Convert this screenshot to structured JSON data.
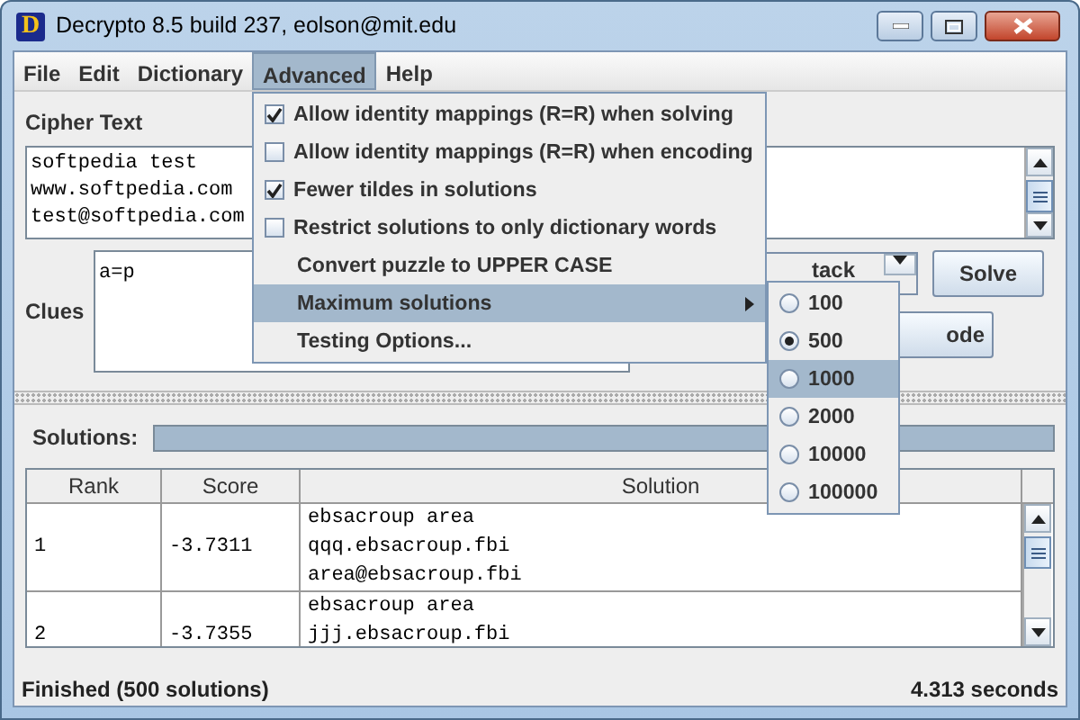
{
  "window": {
    "title": "Decrypto 8.5 build 237, eolson@mit.edu",
    "logo_letter": "D"
  },
  "menu_bar": [
    {
      "label": "File",
      "selected": false
    },
    {
      "label": "Edit",
      "selected": false
    },
    {
      "label": "Dictionary",
      "selected": false
    },
    {
      "label": "Advanced",
      "selected": true
    },
    {
      "label": "Help",
      "selected": false
    }
  ],
  "cipher_text": {
    "label": "Cipher Text",
    "lines": [
      "softpedia test",
      "www.softpedia.com",
      "test@softpedia.com"
    ]
  },
  "clues": {
    "label": "Clues",
    "value": "a=p"
  },
  "combo": {
    "value": "tack"
  },
  "solve_button": {
    "label": "Solve"
  },
  "encode_button": {
    "label": "ode"
  },
  "solutions": {
    "label": "Solutions:",
    "level": 1
  },
  "table": {
    "columns": [
      "Rank",
      "Score",
      "Solution"
    ],
    "rows": [
      {
        "rank": "1",
        "score": "-3.7311",
        "solution": [
          "ebsacroup area",
          "qqq.ebsacroup.fbi",
          "area@ebsacroup.fbi"
        ]
      },
      {
        "rank": "2",
        "score": "-3.7355",
        "solution": [
          "ebsacroup area",
          "jjj.ebsacroup.fbi"
        ]
      }
    ]
  },
  "status_bar": {
    "left": "Finished (500 solutions)",
    "right": "4.313 seconds"
  },
  "advanced_menu": [
    {
      "kind": "checkbox",
      "label": "Allow identity mappings (R=R) when solving",
      "checked": true,
      "selected": false
    },
    {
      "kind": "checkbox",
      "label": "Allow identity mappings (R=R) when encoding",
      "checked": false,
      "selected": false
    },
    {
      "kind": "checkbox",
      "label": "Fewer tildes in solutions",
      "checked": true,
      "selected": false
    },
    {
      "kind": "checkbox",
      "label": "Restrict solutions to only dictionary words",
      "checked": false,
      "selected": false
    },
    {
      "kind": "plain",
      "label": "Convert puzzle to UPPER CASE",
      "selected": false
    },
    {
      "kind": "submenu",
      "label": "Maximum solutions",
      "selected": true
    },
    {
      "kind": "plain",
      "label": "Testing Options...",
      "selected": false
    }
  ],
  "max_solutions_menu": [
    {
      "label": "100",
      "checked": false,
      "selected": false
    },
    {
      "label": "500",
      "checked": true,
      "selected": false
    },
    {
      "label": "1000",
      "checked": false,
      "selected": true
    },
    {
      "label": "2000",
      "checked": false,
      "selected": false
    },
    {
      "label": "10000",
      "checked": false,
      "selected": false
    },
    {
      "label": "100000",
      "checked": false,
      "selected": false
    }
  ]
}
